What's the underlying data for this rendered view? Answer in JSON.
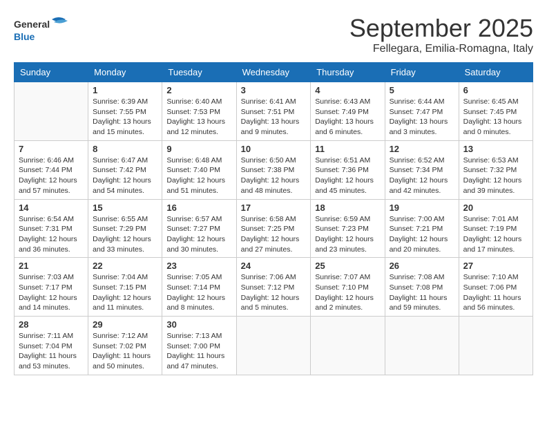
{
  "header": {
    "logo_general": "General",
    "logo_blue": "Blue",
    "title": "September 2025",
    "location": "Fellegara, Emilia-Romagna, Italy"
  },
  "weekdays": [
    "Sunday",
    "Monday",
    "Tuesday",
    "Wednesday",
    "Thursday",
    "Friday",
    "Saturday"
  ],
  "weeks": [
    [
      {
        "day": "",
        "info": ""
      },
      {
        "day": "1",
        "info": "Sunrise: 6:39 AM\nSunset: 7:55 PM\nDaylight: 13 hours\nand 15 minutes."
      },
      {
        "day": "2",
        "info": "Sunrise: 6:40 AM\nSunset: 7:53 PM\nDaylight: 13 hours\nand 12 minutes."
      },
      {
        "day": "3",
        "info": "Sunrise: 6:41 AM\nSunset: 7:51 PM\nDaylight: 13 hours\nand 9 minutes."
      },
      {
        "day": "4",
        "info": "Sunrise: 6:43 AM\nSunset: 7:49 PM\nDaylight: 13 hours\nand 6 minutes."
      },
      {
        "day": "5",
        "info": "Sunrise: 6:44 AM\nSunset: 7:47 PM\nDaylight: 13 hours\nand 3 minutes."
      },
      {
        "day": "6",
        "info": "Sunrise: 6:45 AM\nSunset: 7:45 PM\nDaylight: 13 hours\nand 0 minutes."
      }
    ],
    [
      {
        "day": "7",
        "info": "Sunrise: 6:46 AM\nSunset: 7:44 PM\nDaylight: 12 hours\nand 57 minutes."
      },
      {
        "day": "8",
        "info": "Sunrise: 6:47 AM\nSunset: 7:42 PM\nDaylight: 12 hours\nand 54 minutes."
      },
      {
        "day": "9",
        "info": "Sunrise: 6:48 AM\nSunset: 7:40 PM\nDaylight: 12 hours\nand 51 minutes."
      },
      {
        "day": "10",
        "info": "Sunrise: 6:50 AM\nSunset: 7:38 PM\nDaylight: 12 hours\nand 48 minutes."
      },
      {
        "day": "11",
        "info": "Sunrise: 6:51 AM\nSunset: 7:36 PM\nDaylight: 12 hours\nand 45 minutes."
      },
      {
        "day": "12",
        "info": "Sunrise: 6:52 AM\nSunset: 7:34 PM\nDaylight: 12 hours\nand 42 minutes."
      },
      {
        "day": "13",
        "info": "Sunrise: 6:53 AM\nSunset: 7:32 PM\nDaylight: 12 hours\nand 39 minutes."
      }
    ],
    [
      {
        "day": "14",
        "info": "Sunrise: 6:54 AM\nSunset: 7:31 PM\nDaylight: 12 hours\nand 36 minutes."
      },
      {
        "day": "15",
        "info": "Sunrise: 6:55 AM\nSunset: 7:29 PM\nDaylight: 12 hours\nand 33 minutes."
      },
      {
        "day": "16",
        "info": "Sunrise: 6:57 AM\nSunset: 7:27 PM\nDaylight: 12 hours\nand 30 minutes."
      },
      {
        "day": "17",
        "info": "Sunrise: 6:58 AM\nSunset: 7:25 PM\nDaylight: 12 hours\nand 27 minutes."
      },
      {
        "day": "18",
        "info": "Sunrise: 6:59 AM\nSunset: 7:23 PM\nDaylight: 12 hours\nand 23 minutes."
      },
      {
        "day": "19",
        "info": "Sunrise: 7:00 AM\nSunset: 7:21 PM\nDaylight: 12 hours\nand 20 minutes."
      },
      {
        "day": "20",
        "info": "Sunrise: 7:01 AM\nSunset: 7:19 PM\nDaylight: 12 hours\nand 17 minutes."
      }
    ],
    [
      {
        "day": "21",
        "info": "Sunrise: 7:03 AM\nSunset: 7:17 PM\nDaylight: 12 hours\nand 14 minutes."
      },
      {
        "day": "22",
        "info": "Sunrise: 7:04 AM\nSunset: 7:15 PM\nDaylight: 12 hours\nand 11 minutes."
      },
      {
        "day": "23",
        "info": "Sunrise: 7:05 AM\nSunset: 7:14 PM\nDaylight: 12 hours\nand 8 minutes."
      },
      {
        "day": "24",
        "info": "Sunrise: 7:06 AM\nSunset: 7:12 PM\nDaylight: 12 hours\nand 5 minutes."
      },
      {
        "day": "25",
        "info": "Sunrise: 7:07 AM\nSunset: 7:10 PM\nDaylight: 12 hours\nand 2 minutes."
      },
      {
        "day": "26",
        "info": "Sunrise: 7:08 AM\nSunset: 7:08 PM\nDaylight: 11 hours\nand 59 minutes."
      },
      {
        "day": "27",
        "info": "Sunrise: 7:10 AM\nSunset: 7:06 PM\nDaylight: 11 hours\nand 56 minutes."
      }
    ],
    [
      {
        "day": "28",
        "info": "Sunrise: 7:11 AM\nSunset: 7:04 PM\nDaylight: 11 hours\nand 53 minutes."
      },
      {
        "day": "29",
        "info": "Sunrise: 7:12 AM\nSunset: 7:02 PM\nDaylight: 11 hours\nand 50 minutes."
      },
      {
        "day": "30",
        "info": "Sunrise: 7:13 AM\nSunset: 7:00 PM\nDaylight: 11 hours\nand 47 minutes."
      },
      {
        "day": "",
        "info": ""
      },
      {
        "day": "",
        "info": ""
      },
      {
        "day": "",
        "info": ""
      },
      {
        "day": "",
        "info": ""
      }
    ]
  ]
}
